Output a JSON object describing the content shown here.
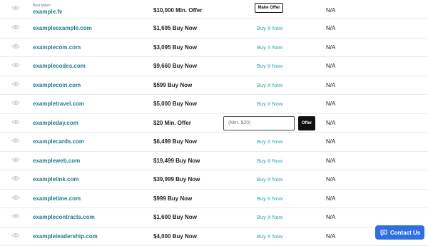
{
  "listings": [
    {
      "best_match_label": "Best Match",
      "domain": "example.fv",
      "price": "$10,000 Min. Offer",
      "action": "Make Offer",
      "status": "N/A"
    },
    {
      "domain": "exampleexample.com",
      "price": "$1,695 Buy Now",
      "action": "Buy It Now",
      "status": "N/A"
    },
    {
      "domain": "examplecom.com",
      "price": "$3,095 Buy Now",
      "action": "Buy It Now",
      "status": "N/A"
    },
    {
      "domain": "examplecodes.com",
      "price": "$9,660 Buy Now",
      "action": "Buy It Now",
      "status": "N/A"
    },
    {
      "domain": "examplecoin.com",
      "price": "$599 Buy Now",
      "action": "Buy It Now",
      "status": "N/A"
    },
    {
      "domain": "exampletravel.com",
      "price": "$5,000 Buy Now",
      "action": "Buy It Now",
      "status": "N/A"
    },
    {
      "domain": "exampleday.com",
      "price": "$20 Min. Offer",
      "offer_placeholder": "(Min. $20)",
      "offer_button": "Offer",
      "status": "N/A"
    },
    {
      "domain": "examplecards.com",
      "price": "$6,499 Buy Now",
      "action": "Buy It Now",
      "status": "N/A"
    },
    {
      "domain": "exampleweb.com",
      "price": "$19,499 Buy Now",
      "action": "Buy It Now",
      "status": "N/A"
    },
    {
      "domain": "examplelink.com",
      "price": "$39,999 Buy Now",
      "action": "Buy It Now",
      "status": "N/A"
    },
    {
      "domain": "exampletime.com",
      "price": "$999 Buy Now",
      "action": "Buy It Now",
      "status": "N/A"
    },
    {
      "domain": "examplecontracts.com",
      "price": "$1,600 Buy Now",
      "action": "Buy It Now",
      "status": "N/A"
    },
    {
      "domain": "exampleleadership.com",
      "price": "$4,000 Buy Now",
      "action": "Buy It Now",
      "status": "N/A"
    }
  ],
  "contact_button": {
    "label": "Contact Us",
    "icon": "chat-icon"
  },
  "colors": {
    "domain": "#1f7a8c",
    "buy_link": "#2aa5a8",
    "contact_bg": "#2f6fe0"
  }
}
